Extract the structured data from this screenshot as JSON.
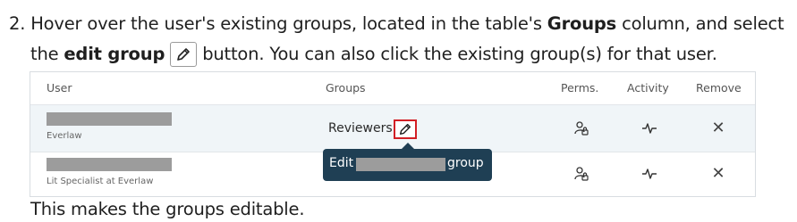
{
  "instruction": {
    "number": "2.",
    "line1_part1": "Hover over the user's existing groups, located in the table's",
    "line1_bold": "Groups",
    "line1_part2": "column, and select",
    "line2_part1": "the",
    "line2_bold": "edit group",
    "line2_part2": "button. You can also click the existing group(s) for that user."
  },
  "table": {
    "headers": {
      "user": "User",
      "groups": "Groups",
      "perms": "Perms.",
      "activity": "Activity",
      "remove": "Remove"
    },
    "rows": [
      {
        "subtext": "Everlaw",
        "group": "Reviewers"
      },
      {
        "subtext": "Lit Specialist at Everlaw",
        "group": ""
      }
    ]
  },
  "tooltip": {
    "edit": "Edit",
    "group": "group"
  },
  "footer": "This makes the groups editable.",
  "colors": {
    "highlight_border": "#d21f25",
    "tooltip_bg": "#1f3f54",
    "row_highlight": "#f0f5f8"
  }
}
